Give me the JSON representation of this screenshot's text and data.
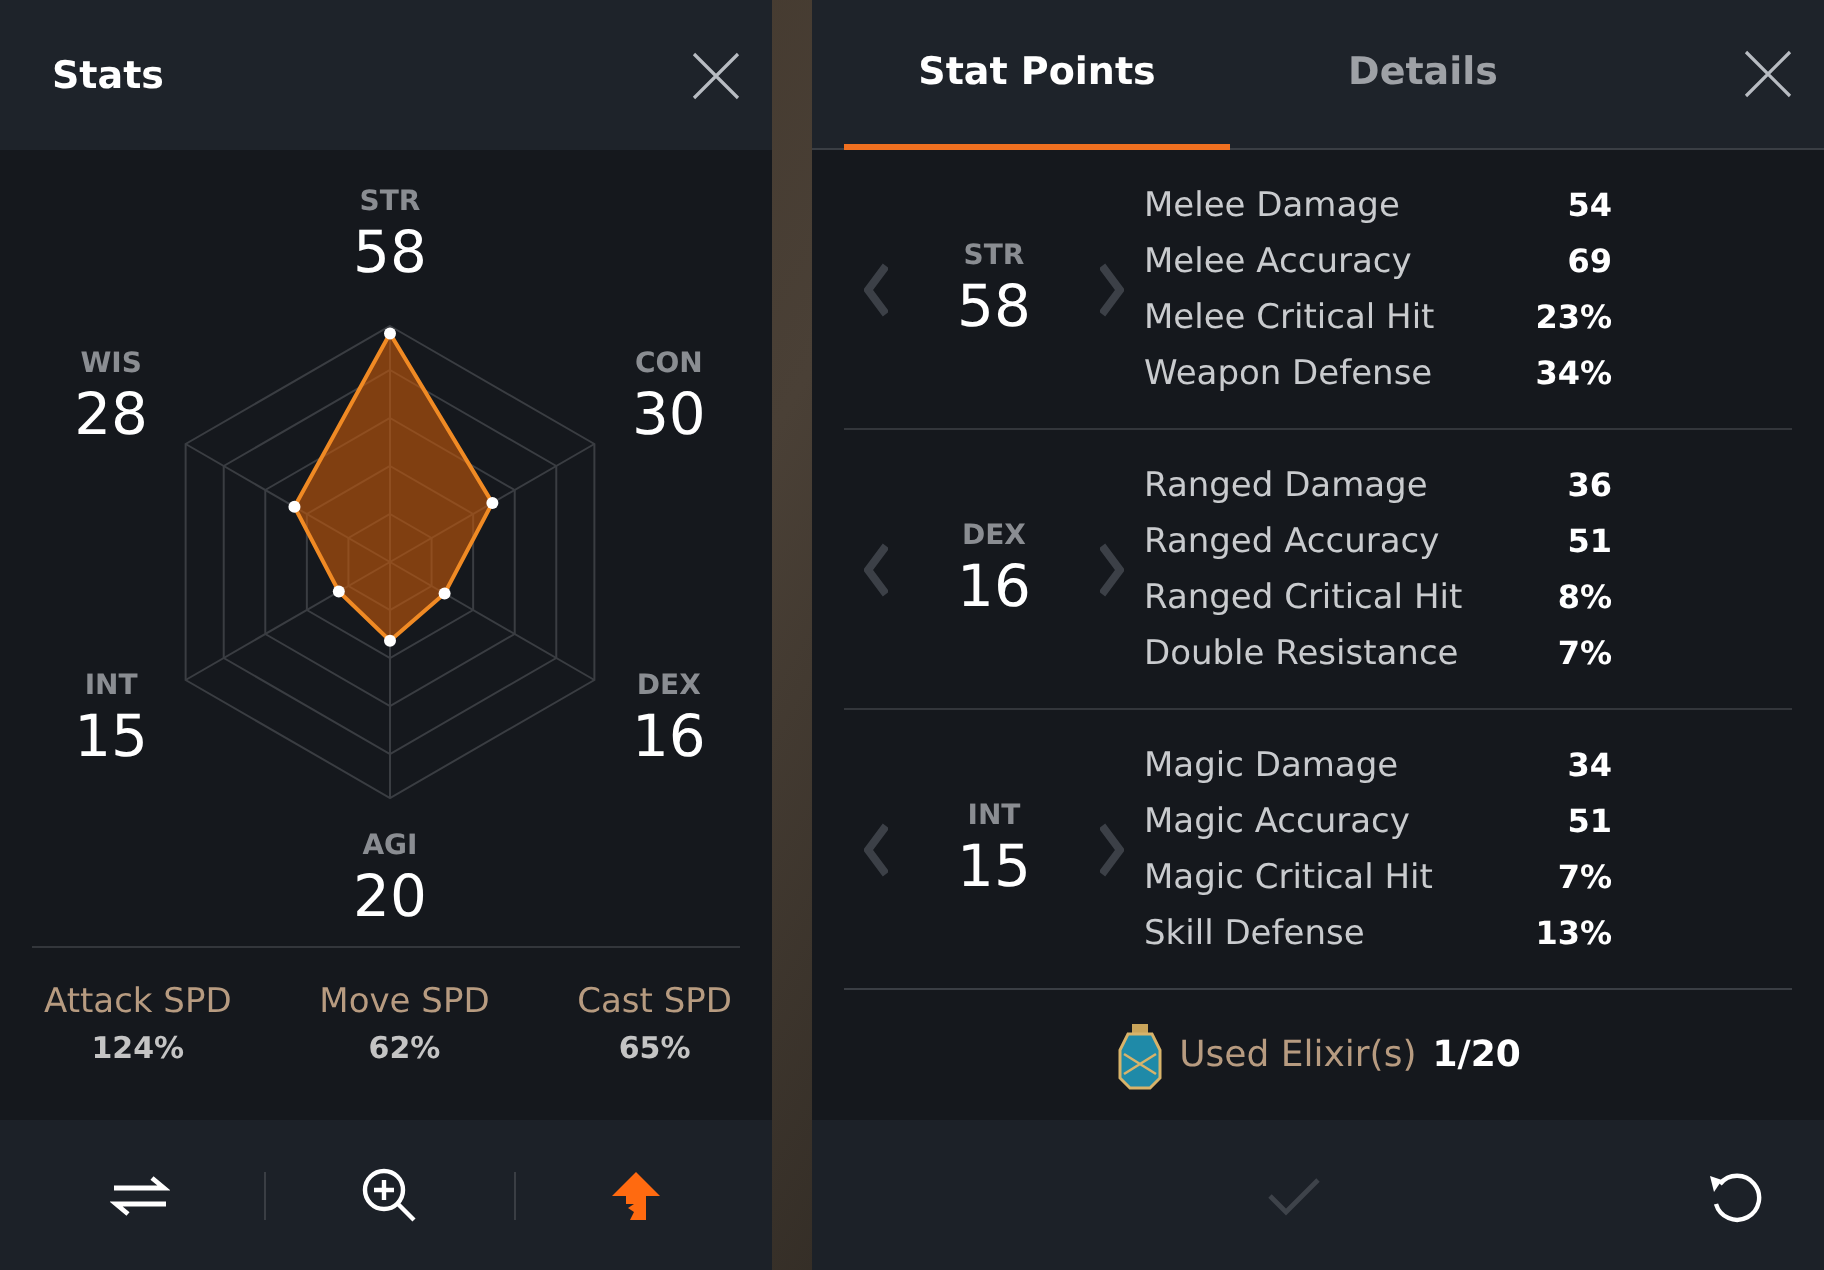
{
  "stats_panel": {
    "title": "Stats",
    "radar": [
      {
        "label": "STR",
        "value": "58"
      },
      {
        "label": "WIS",
        "value": "28"
      },
      {
        "label": "CON",
        "value": "30"
      },
      {
        "label": "INT",
        "value": "15"
      },
      {
        "label": "DEX",
        "value": "16"
      },
      {
        "label": "AGI",
        "value": "20"
      }
    ],
    "speeds": [
      {
        "label": "Attack SPD",
        "value": "124%"
      },
      {
        "label": "Move SPD",
        "value": "62%"
      },
      {
        "label": "Cast SPD",
        "value": "65%"
      }
    ],
    "toolbar": [
      {
        "kind": "swap"
      },
      {
        "kind": "zoom"
      },
      {
        "kind": "upgrade"
      }
    ]
  },
  "details_panel": {
    "tabs": [
      {
        "label": "Stat Points",
        "selected": true
      },
      {
        "label": "Details",
        "selected": false
      }
    ],
    "groups": [
      {
        "stat": "STR",
        "value": "58",
        "rows": [
          {
            "name": "Melee Damage",
            "value": "54"
          },
          {
            "name": "Melee Accuracy",
            "value": "69"
          },
          {
            "name": "Melee Critical Hit",
            "value": "23%"
          },
          {
            "name": "Weapon Defense",
            "value": "34%"
          }
        ]
      },
      {
        "stat": "DEX",
        "value": "16",
        "rows": [
          {
            "name": "Ranged Damage",
            "value": "36"
          },
          {
            "name": "Ranged Accuracy",
            "value": "51"
          },
          {
            "name": "Ranged Critical Hit",
            "value": "8%"
          },
          {
            "name": "Double Resistance",
            "value": "7%"
          }
        ]
      },
      {
        "stat": "INT",
        "value": "15",
        "rows": [
          {
            "name": "Magic Damage",
            "value": "34"
          },
          {
            "name": "Magic Accuracy",
            "value": "51"
          },
          {
            "name": "Magic Critical Hit",
            "value": "7%"
          },
          {
            "name": "Skill Defense",
            "value": "13%"
          }
        ]
      }
    ],
    "elixir": {
      "label": "Used Elixir(s)",
      "value": "1/20"
    },
    "confirm": {
      "disabled": true
    }
  }
}
